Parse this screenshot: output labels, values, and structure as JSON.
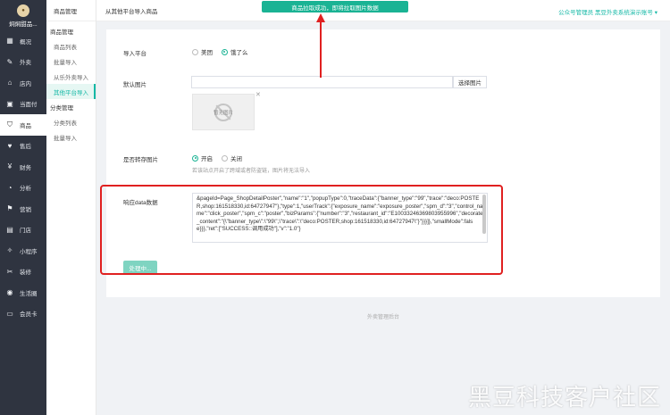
{
  "brand": {
    "name": "焖焖甜品..."
  },
  "nav": [
    {
      "label": "概况",
      "icon": "chart-icon"
    },
    {
      "label": "外卖",
      "icon": "takeout-icon"
    },
    {
      "label": "店内",
      "icon": "store-icon"
    },
    {
      "label": "当面付",
      "icon": "pay-icon"
    },
    {
      "label": "商品",
      "icon": "goods-icon"
    },
    {
      "label": "售后",
      "icon": "aftersale-icon"
    },
    {
      "label": "财务",
      "icon": "finance-icon"
    },
    {
      "label": "分析",
      "icon": "analytics-icon"
    },
    {
      "label": "营销",
      "icon": "marketing-icon"
    },
    {
      "label": "门店",
      "icon": "shop-icon"
    },
    {
      "label": "小程序",
      "icon": "miniapp-icon"
    },
    {
      "label": "装修",
      "icon": "decorate-icon"
    },
    {
      "label": "生活圈",
      "icon": "life-icon"
    },
    {
      "label": "会员卡",
      "icon": "member-card-icon"
    }
  ],
  "sub": {
    "header": "商品管理",
    "group1": "商品管理",
    "items1": [
      "商品列表",
      "批量导入",
      "从乐外卖导入",
      "其他平台导入"
    ],
    "group2": "分类管理",
    "items2": [
      "分类列表",
      "批量导入"
    ]
  },
  "top": {
    "title": "从其他平台导入商品",
    "account": "公众号管理员 黑豆外卖系统演示账号",
    "toast": "商品拉取成功，即将拉取图片数据"
  },
  "form": {
    "platform_label": "导入平台",
    "platform_options": [
      "美团",
      "饿了么"
    ],
    "default_image_label": "默认图片",
    "choose_image": "选择图片",
    "no_image": "暂无图片",
    "transfer_label": "是否转存图片",
    "transfer_options": [
      "开启",
      "关闭"
    ],
    "transfer_hint": "若该站点开启了跨域或者防盗链，图片将无法导入",
    "response_label": "响应data数据",
    "response_text": "&pageId=Page_ShopDetailPoster\",\"name\":\"1\",\"popupType\":0,\"traceData\":{\"banner_type\":\"99\",\"trace\":\"deco:POSTER,shop:161518330,id:64727947\"},\"type\":1,\"userTrack\":{\"exposure_name\":\"exposure_poster\",\"spm_d\":\"3\",\"control_name\":\"click_poster\",\"spm_c\":\"poster\",\"bizParams\":{\"number\":\"3\",\"restaurant_id\":\"E10033246369803955996\",\"decorate_content\":\"{\\\"banner_type\\\":\\\"99\\\",\\\"trace\\\":\\\"deco:POSTER,shop:161518330,id:64727947\\\"}\"}}}]},\"smallMode\":false}}},\"ret\":[\"SUCCESS::调用成功\"],\"v\":\"1.0\"}",
    "submit": "处理中..."
  },
  "footer": "外卖管理后台",
  "watermark": "黑豆科技客户社区"
}
